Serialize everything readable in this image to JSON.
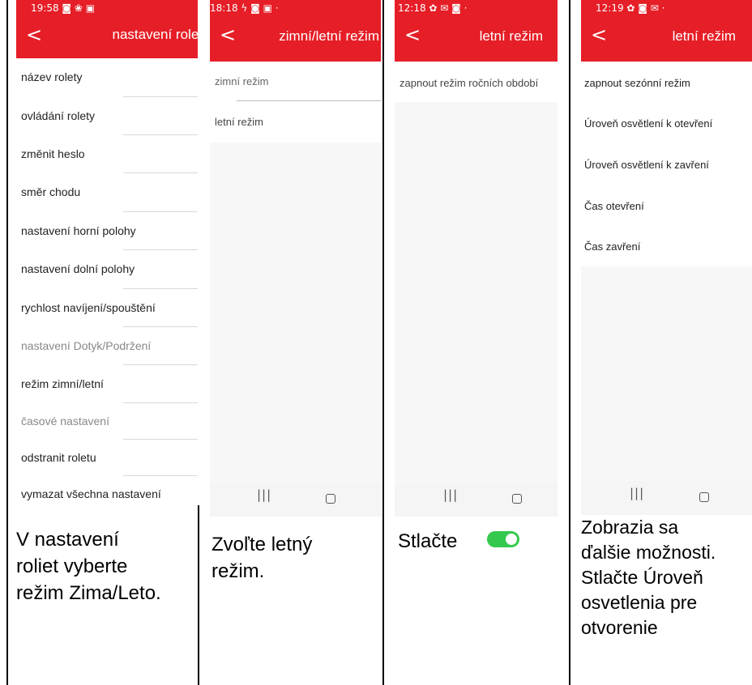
{
  "screens": [
    {
      "status": "19:58 ◙ ❀ ▣",
      "title": "nastavení rolet",
      "items": [
        "název rolety",
        "ovládání rolety",
        "změnit heslo",
        "směr chodu",
        "nastavení horní polohy",
        "nastavení dolní polohy",
        "rychlost navíjení/spouštění",
        "nastavení Dotyk/Podržení",
        "režim zimní/letní",
        "časové nastavení",
        "odstranit roletu",
        "vymazat všechna nastavení"
      ],
      "caption": [
        "V nastavení",
        "roliet vyberte",
        "režim Zima/Leto."
      ]
    },
    {
      "status": "18:18 ϟ ◙ ▣ ·",
      "title": "zimní/letní režim",
      "items": [
        "zimní režim",
        "letní režim"
      ],
      "nav": {
        "recents": "|||",
        "home": ""
      },
      "caption": [
        "Zvoľte letný",
        "režim."
      ]
    },
    {
      "status": "12:18 ✿ ✉ ◙ ·",
      "title": "letní režim",
      "items": [
        "zapnout režim ročních období"
      ],
      "nav": {
        "recents": "|||",
        "home": ""
      },
      "caption": [
        "Stlačte"
      ]
    },
    {
      "status": "12:19 ✿ ◙ ✉ ·",
      "title": "letní režim",
      "items": [
        "zapnout sezónní režim",
        "Úroveň osvětlení k otevření",
        "Úroveň osvětlení k zavření",
        "Čas otevření",
        "Čas zavření"
      ],
      "nav": {
        "recents": "|||",
        "home": ""
      },
      "caption": [
        "Zobrazia sa",
        "ďalšie možnosti.",
        "Stlačte Úroveň",
        "osvetlenia pre",
        "otvorenie"
      ]
    }
  ],
  "icons": {
    "back": "chevron-left-icon",
    "toggle": "toggle-on-icon"
  },
  "colors": {
    "accent": "#e61e27",
    "toggle": "#34c94e"
  }
}
